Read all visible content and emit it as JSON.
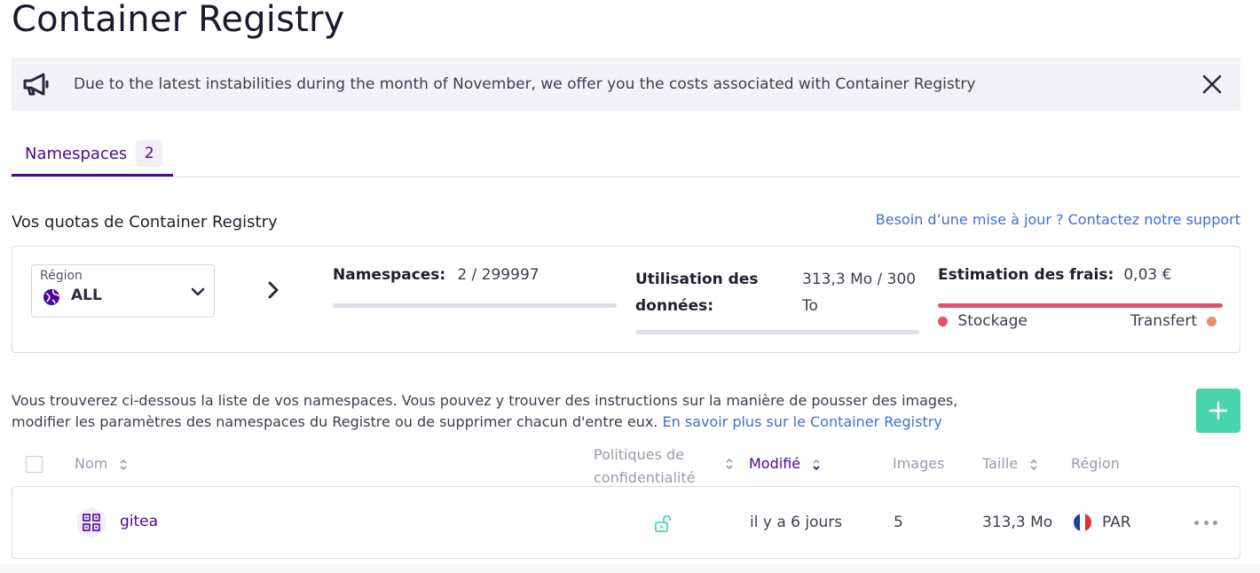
{
  "page": {
    "title": "Container Registry"
  },
  "banner": {
    "text": "Due to the latest instabilities during the month of November, we offer you the costs associated with Container Registry"
  },
  "tabs": [
    {
      "label": "Namespaces",
      "count": "2"
    }
  ],
  "quota": {
    "title": "Vos quotas de Container Registry",
    "support_link": "Besoin d’une mise à jour ? Contactez notre support",
    "region": {
      "label": "Région",
      "value": "ALL"
    },
    "namespaces": {
      "label": "Namespaces:",
      "value": "2 / 299997",
      "fill": 0.0
    },
    "data_usage": {
      "label_line1": "Utilisation des",
      "label_line2": "données:",
      "value_line1": "313,3 Mo / 300",
      "value_line2": "To",
      "fill": 0.0
    },
    "fees": {
      "label": "Estimation des frais:",
      "value": "0,03 €",
      "legend_storage": "Stockage",
      "legend_transfer": "Transfert"
    }
  },
  "description": {
    "line1": "Vous trouverez ci-dessous la liste de vos namespaces. Vous pouvez y trouver des instructions sur la manière de pousser des images,",
    "line2": "modifier les paramètres des namespaces du Registre ou de supprimer chacun d'entre eux.",
    "link": "En savoir plus sur le Container Registry"
  },
  "table": {
    "headers": {
      "name": "Nom",
      "privacy_line1": "Politiques de",
      "privacy_line2": "confidentialité",
      "modified": "Modifié",
      "images": "Images",
      "size": "Taille",
      "region": "Région"
    },
    "rows": [
      {
        "name": "gitea",
        "modified": "il y a 6 jours",
        "images": "5",
        "size": "313,3 Mo",
        "region": "PAR"
      }
    ]
  },
  "colors": {
    "accent": "#4f0599",
    "link": "#3d6fd6",
    "add_button": "#4ad6ad",
    "storage": "#e5506d",
    "transfer": "#f08a6a",
    "public_lock": "#4ad6ad"
  },
  "icons": {
    "banner": "megaphone-icon",
    "close": "close-icon",
    "globe": "globe-icon",
    "chevron": "chevron-down-icon",
    "next": "chevron-right-icon",
    "add": "plus-icon",
    "lock": "unlock-icon",
    "flag": "france-flag-icon",
    "more": "more-icon"
  }
}
